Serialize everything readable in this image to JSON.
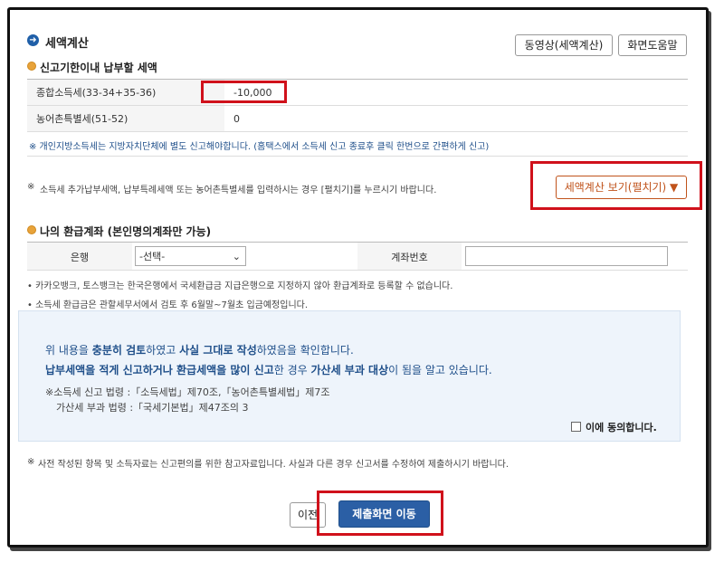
{
  "header": {
    "title": "세액계산",
    "video_button": "동영상(세액계산)",
    "help_button": "화면도움말"
  },
  "tax_section": {
    "title": "신고기한이내 납부할 세액",
    "rows": [
      {
        "label": "종합소득세(33-34+35-36)",
        "value": "-10,000"
      },
      {
        "label": "농어촌특별세(51-52)",
        "value": "0"
      }
    ],
    "note_local": "※ 개인지방소득세는 지방자치단체에 별도 신고해야합니다. (홈택스에서 소득세 신고 종료후 클릭 한번으로 간편하게 신고)",
    "note_extra": "소득세 추가납부세액, 납부특례세액 또는 농어촌특별세를 입력하시는 경우 [펼치기]를 누르시기 바랍니다.",
    "expand_button": "세액계산 보기(펼치기) ▼"
  },
  "refund_section": {
    "title": "나의 환급계좌 (본인명의계좌만 가능)",
    "bank_label": "은행",
    "bank_selected": "-선택-",
    "account_label": "계좌번호",
    "account_value": "",
    "note1": "카카오뱅크, 토스뱅크는 한국은행에서 국세환급금 지급은행으로 지정하지 않아 환급계좌로 등록할 수 없습니다.",
    "note2": "소득세 환급금은 관할세무서에서 검토 후 6월말~7월초 입금예정입니다."
  },
  "confirm_box": {
    "line1_a": "위 내용을 ",
    "line1_b": "충분히 검토",
    "line1_c": "하였고 ",
    "line1_d": "사실 그대로 작성",
    "line1_e": "하였음을 확인합니다.",
    "line2_a": "납부세액을 적게 신고하거나 환급세액을 많이 신고",
    "line2_b": "한 경우 ",
    "line2_c": "가산세 부과 대상",
    "line2_d": "이 됨을 알고 있습니다.",
    "law1": "※소득세 신고 법령 :「소득세법」제70조,「농어촌특별세법」제7조",
    "law2": "가산세 부과 법령 :「국세기본법」제47조의 3",
    "agree_label": "이에 동의합니다."
  },
  "footer": {
    "note": "사전 작성된 항목 및 소득자료는 신고편의를 위한 참고자료입니다. 사실과 다른 경우 신고서를 수정하여 제출하시기 바랍니다.",
    "prev_button": "이전",
    "submit_button": "제출화면 이동"
  },
  "colors": {
    "accent_blue": "#1f5fa8",
    "highlight_red": "#d0111b",
    "expand_orange": "#c0531b"
  }
}
